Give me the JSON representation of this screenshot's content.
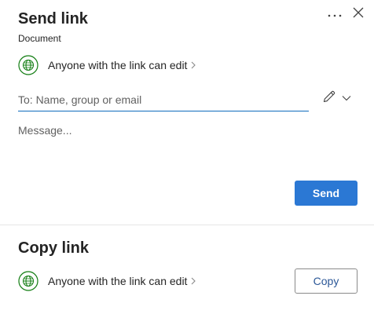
{
  "send_section": {
    "title": "Send link",
    "subtitle": "Document",
    "permission_text": "Anyone with the link can edit",
    "to_placeholder": "To: Name, group or email",
    "to_value": "",
    "message_placeholder": "Message...",
    "send_label": "Send"
  },
  "copy_section": {
    "title": "Copy link",
    "permission_text": "Anyone with the link can edit",
    "copy_label": "Copy"
  },
  "icons": {
    "more": "more-options-icon",
    "close": "close-icon",
    "globe": "globe-icon",
    "chevron_right": "chevron-right-icon",
    "pencil": "pencil-icon",
    "chevron_down": "chevron-down-icon"
  },
  "colors": {
    "accent": "#2b78d4",
    "globe_green": "#107c10",
    "input_underline": "#0f6cbd"
  }
}
